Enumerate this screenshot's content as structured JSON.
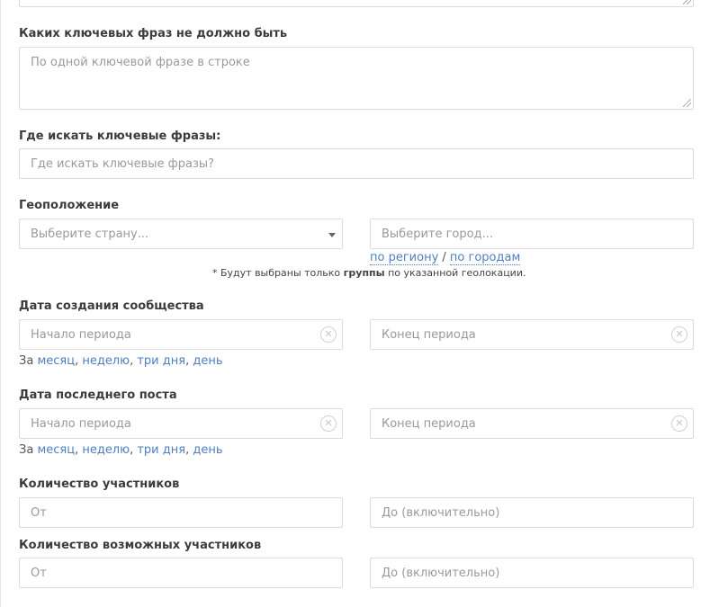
{
  "top_textarea": {
    "value": ""
  },
  "exclude_phrases": {
    "label": "Каких ключевых фраз не должно быть",
    "placeholder": "По одной ключевой фразе в строке"
  },
  "search_where": {
    "label": "Где искать ключевые фразы:",
    "placeholder": "Где искать ключевые фразы?"
  },
  "geo": {
    "label": "Геоположение",
    "country_placeholder": "Выберите страну...",
    "city_placeholder": "Выберите город...",
    "by_region": "по региону",
    "separator": " / ",
    "by_cities": "по городам",
    "note_prefix": "* Будут выбраны только ",
    "note_bold": "группы",
    "note_suffix": " по указанной геолокации."
  },
  "created_date": {
    "label": "Дата создания сообщества",
    "start_placeholder": "Начало периода",
    "end_placeholder": "Конец периода",
    "quick_prefix": "За ",
    "quick_month": "месяц",
    "quick_week": "неделю",
    "quick_three_days": "три дня",
    "quick_day": "день",
    "comma": ", "
  },
  "last_post_date": {
    "label": "Дата последнего поста",
    "start_placeholder": "Начало периода",
    "end_placeholder": "Конец периода",
    "quick_prefix": "За ",
    "quick_month": "месяц",
    "quick_week": "неделю",
    "quick_three_days": "три дня",
    "quick_day": "день",
    "comma": ", "
  },
  "members_count": {
    "label": "Количество участников",
    "from_placeholder": "От",
    "to_placeholder": "До (включительно)"
  },
  "possible_members_count": {
    "label": "Количество возможных участников",
    "from_placeholder": "От",
    "to_placeholder": "До (включительно)"
  },
  "clear_icon_glyph": "✕",
  "colors": {
    "link": "#4f7fc1",
    "border": "#dcdcdc",
    "placeholder": "#9a9a9a"
  }
}
